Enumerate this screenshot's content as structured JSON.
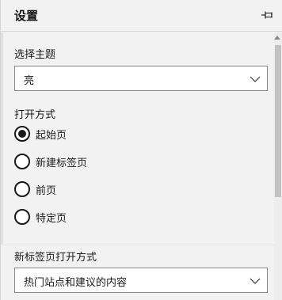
{
  "header": {
    "title": "设置",
    "pin_icon": "pin-icon"
  },
  "theme": {
    "label": "选择主题",
    "selected": "亮"
  },
  "open_with": {
    "label": "打开方式",
    "options": [
      {
        "label": "起始页",
        "checked": true
      },
      {
        "label": "新建标签页",
        "checked": false
      },
      {
        "label": "前页",
        "checked": false
      },
      {
        "label": "特定页",
        "checked": false
      }
    ]
  },
  "new_tab": {
    "label": "新标签页打开方式",
    "selected": "热门站点和建议的内容"
  }
}
